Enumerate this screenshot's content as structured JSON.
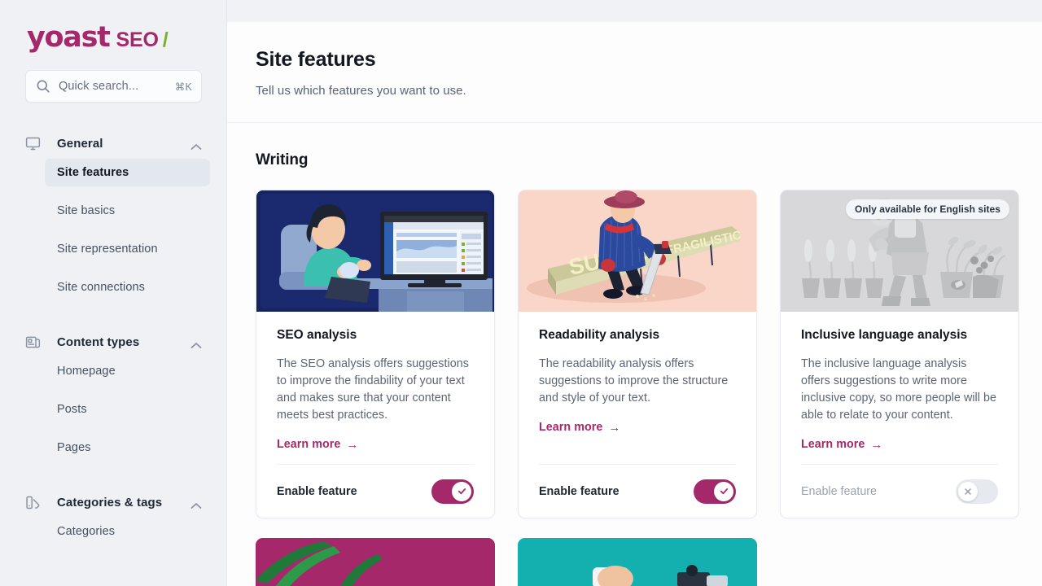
{
  "brand": {
    "name": "yoast",
    "product": "SEO",
    "slash": "/"
  },
  "search": {
    "placeholder": "Quick search...",
    "shortcut": "⌘K",
    "icon": "search-icon"
  },
  "sidebar": {
    "groups": [
      {
        "label": "General",
        "icon": "monitor-icon",
        "expanded": true,
        "items": [
          {
            "label": "Site features",
            "active": true
          },
          {
            "label": "Site basics",
            "active": false
          },
          {
            "label": "Site representation",
            "active": false
          },
          {
            "label": "Site connections",
            "active": false
          }
        ]
      },
      {
        "label": "Content types",
        "icon": "articles-icon",
        "expanded": true,
        "items": [
          {
            "label": "Homepage",
            "active": false
          },
          {
            "label": "Posts",
            "active": false
          },
          {
            "label": "Pages",
            "active": false
          }
        ]
      },
      {
        "label": "Categories & tags",
        "icon": "tag-swatch-icon",
        "expanded": true,
        "items": [
          {
            "label": "Categories",
            "active": false
          }
        ]
      }
    ]
  },
  "header": {
    "title": "Site features",
    "subtitle": "Tell us which features you want to use."
  },
  "section": {
    "title": "Writing"
  },
  "cards": [
    {
      "title": "SEO analysis",
      "description": "The SEO analysis offers suggestions to improve the findability of your text and makes sure that your content meets best practices.",
      "learn_more": "Learn more",
      "arrow": "→",
      "toggle_label": "Enable feature",
      "enabled": true,
      "disabled": false,
      "badge": null,
      "image": "woman-at-desk-with-monitor-illustration",
      "image_bg": "#1a2a6b"
    },
    {
      "title": "Readability analysis",
      "description": "The readability analysis offers suggestions to improve the structure and style of your text.",
      "learn_more": "Learn more",
      "arrow": "→",
      "toggle_label": "Enable feature",
      "enabled": true,
      "disabled": false,
      "badge": null,
      "image": "person-sawing-long-word-illustration",
      "image_bg": "#f8d3c4"
    },
    {
      "title": "Inclusive language analysis",
      "description": "The inclusive language analysis offers suggestions to write more inclusive copy, so more people will be able to relate to your content.",
      "learn_more": "Learn more",
      "arrow": "→",
      "toggle_label": "Enable feature",
      "enabled": false,
      "disabled": true,
      "badge": "Only available for English sites",
      "image": "gardener-with-plants-illustration-greyscale",
      "image_bg": "#d6d8db"
    }
  ],
  "cards_row2": [
    {
      "image": "magenta-leaves-illustration",
      "image_bg": "#a4286a"
    },
    {
      "image": "teal-person-illustration",
      "image_bg": "#14b0b0"
    }
  ],
  "colors": {
    "brand_magenta": "#a4286a",
    "brand_green": "#77b227",
    "toggle_on": "#a4286a",
    "toggle_off": "#e6e9ef",
    "sidebar_bg": "#eff1f5",
    "page_bg": "#fdfdfe"
  },
  "icons": {
    "check": "✓",
    "cross": "✕",
    "chevron_up": "chevron-up-icon"
  }
}
